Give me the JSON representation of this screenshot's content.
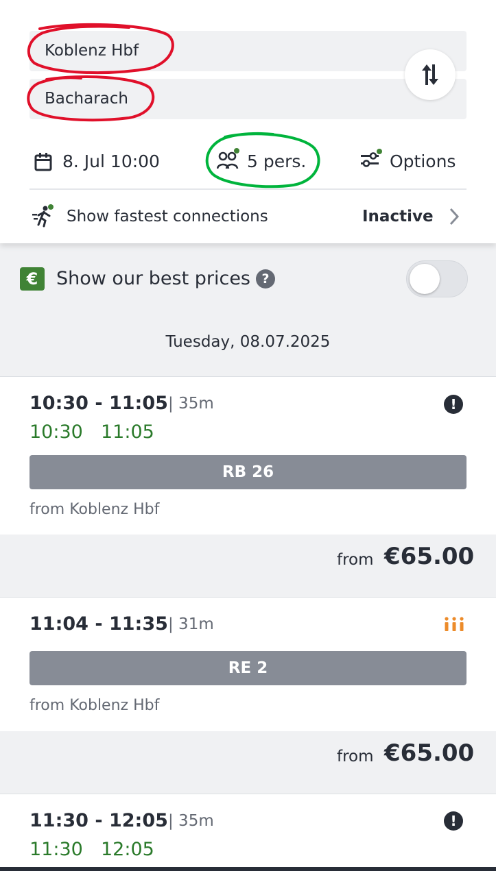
{
  "search": {
    "from": "Koblenz Hbf",
    "to": "Bacharach",
    "date": "8. Jul 10:00",
    "travellers": "5 pers.",
    "options": "Options",
    "fastest_label": "Show fastest connections",
    "fastest_state": "Inactive"
  },
  "best_prices": {
    "badge": "€",
    "label": "Show our best prices",
    "help": "?"
  },
  "date_header": "Tuesday, 08.07.2025",
  "connections": [
    {
      "times": "10:30 - 11:05",
      "duration": "| 35m",
      "rt_dep": "10:30",
      "rt_arr": "11:05",
      "train": "RB 26",
      "from": "from Koblenz Hbf",
      "price_prefix": "from",
      "price": "€65.00",
      "icon": "warning-icon"
    },
    {
      "times": "11:04 - 11:35",
      "duration": "| 31m",
      "train": "RE 2",
      "from": "from Koblenz Hbf",
      "price_prefix": "from",
      "price": "€65.00",
      "icon": "occupancy-high-icon"
    },
    {
      "times": "11:30 - 12:05",
      "duration": "| 35m",
      "rt_dep": "11:30",
      "rt_arr": "12:05",
      "icon": "warning-icon"
    }
  ],
  "colors": {
    "realtime": "#2a7a2a",
    "train_bar": "#878c96",
    "euro_badge": "#408335",
    "occupancy": "#ec8b2a",
    "annotation_red": "#e0102a",
    "annotation_green": "#00b43c"
  }
}
